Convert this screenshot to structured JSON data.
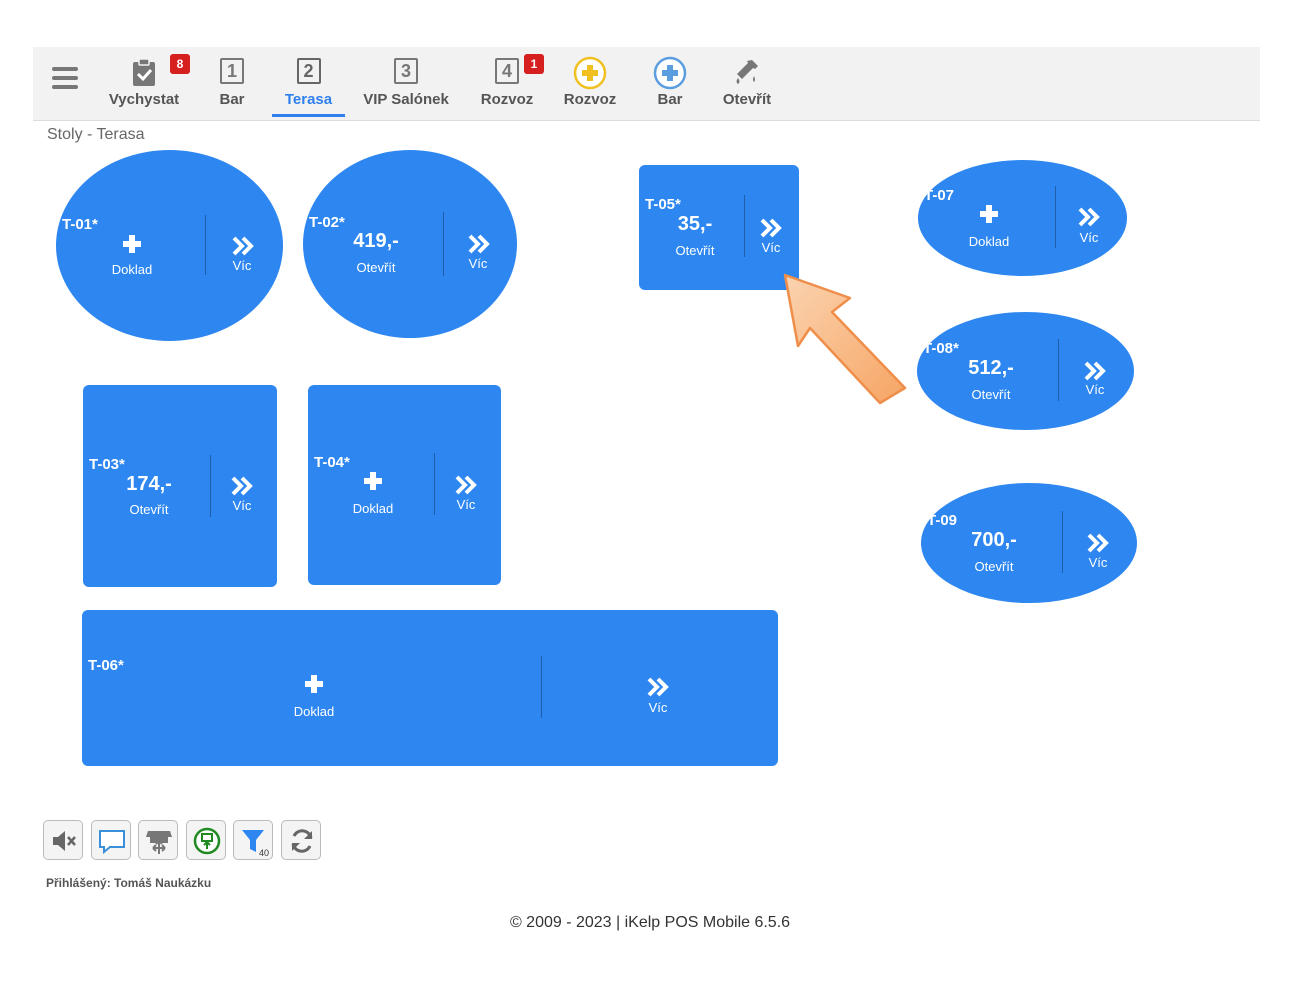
{
  "nav": {
    "items": [
      {
        "label": "Vychystat",
        "badge": "8",
        "icon": "clipboard-check-icon"
      },
      {
        "label": "Bar",
        "number": "1",
        "icon": "bar-1-icon"
      },
      {
        "label": "Terasa",
        "number": "2",
        "icon": "terasa-2-icon",
        "active": true
      },
      {
        "label": "VIP Salónek",
        "number": "3",
        "icon": "vip-3-icon"
      },
      {
        "label": "Rozvoz",
        "number": "4",
        "badge": "1",
        "icon": "rozvoz-4-icon"
      },
      {
        "label": "Rozvoz",
        "icon": "plus-circle-yellow-icon"
      },
      {
        "label": "Bar",
        "icon": "plus-circle-blue-icon"
      },
      {
        "label": "Otevřít",
        "icon": "bottle-icon"
      }
    ]
  },
  "section_title": "Stoly - Terasa",
  "tables": [
    {
      "id": "T-01*",
      "action": "Doklad",
      "more": "Víc"
    },
    {
      "id": "T-02*",
      "amount": "419,-",
      "action": "Otevřít",
      "more": "Víc"
    },
    {
      "id": "T-05*",
      "amount": "35,-",
      "action": "Otevřít",
      "more": "Víc"
    },
    {
      "id": "T-07",
      "action": "Doklad",
      "more": "Víc"
    },
    {
      "id": "T-08*",
      "amount": "512,-",
      "action": "Otevřít",
      "more": "Víc"
    },
    {
      "id": "T-03*",
      "amount": "174,-",
      "action": "Otevřít",
      "more": "Víc"
    },
    {
      "id": "T-04*",
      "action": "Doklad",
      "more": "Víc"
    },
    {
      "id": "T-09",
      "amount": "700,-",
      "action": "Otevřít",
      "more": "Víc"
    },
    {
      "id": "T-06*",
      "action": "Doklad",
      "more": "Víc"
    }
  ],
  "toolbar": {
    "filter_count": "40",
    "tools": [
      "mute-icon",
      "chat-icon",
      "store-move-icon",
      "cash-upload-icon",
      "filter-icon",
      "refresh-icon"
    ]
  },
  "logged_in": "Přihlášený: Tomáš Naukázku",
  "footer": "© 2009 - 2023 | iKelp POS Mobile 6.5.6",
  "colors": {
    "table": "#2e87f0",
    "active": "#2f80ed",
    "badge": "#d62020",
    "arrow": "#f8b27a"
  }
}
